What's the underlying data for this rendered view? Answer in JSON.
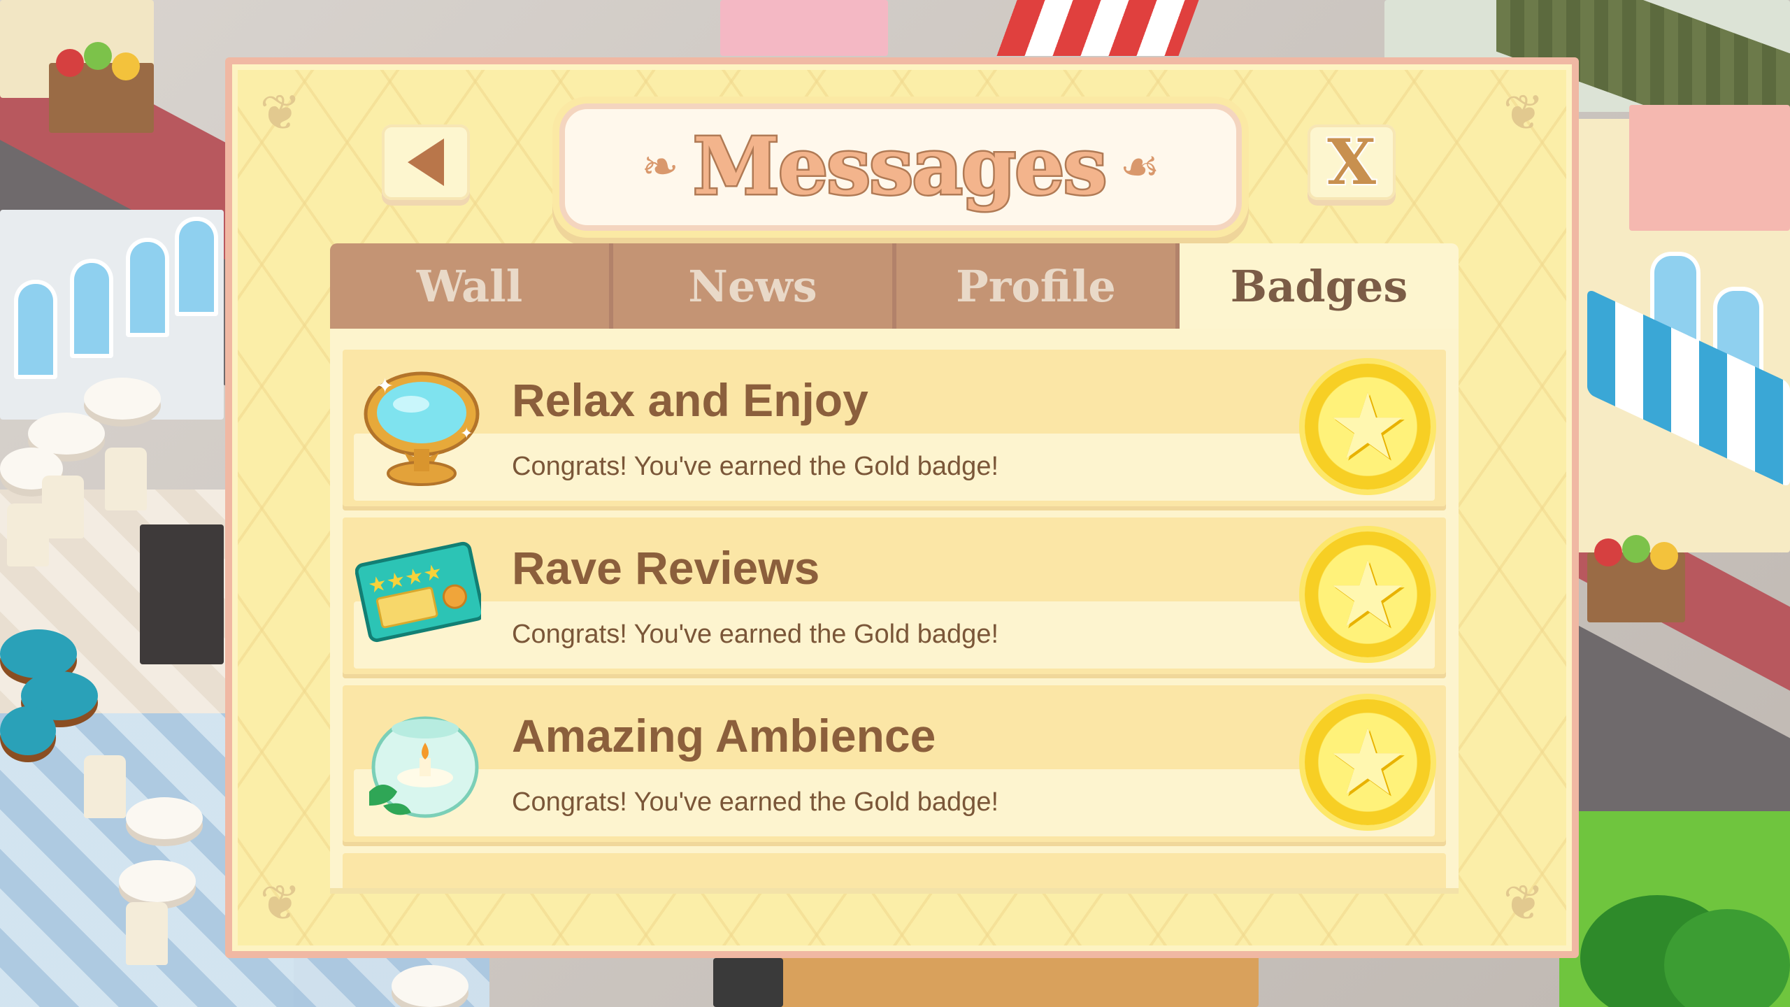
{
  "dialog": {
    "title": "Messages",
    "close_label": "X"
  },
  "tabs": [
    {
      "label": "Wall",
      "active": false
    },
    {
      "label": "News",
      "active": false
    },
    {
      "label": "Profile",
      "active": false
    },
    {
      "label": "Badges",
      "active": true
    }
  ],
  "badges": [
    {
      "title": "Relax and Enjoy",
      "description": "Congrats! You've earned the Gold badge!",
      "icon": "mirror-icon",
      "award": "gold-star-badge-icon"
    },
    {
      "title": "Rave Reviews",
      "description": "Congrats! You've earned the Gold badge!",
      "icon": "review-card-icon",
      "award": "gold-star-badge-icon"
    },
    {
      "title": "Amazing Ambience",
      "description": "Congrats! You've earned the Gold badge!",
      "icon": "candle-bowl-icon",
      "award": "gold-star-badge-icon"
    }
  ],
  "colors": {
    "dialog_bg": "#fbeea8",
    "dialog_border": "#f0b8a3",
    "tab_inactive": "#c49474",
    "tab_active": "#fdf5cf",
    "title_text": "#f3b48c",
    "badge_title": "#8b5f3c",
    "gold": "#f7cf24"
  }
}
